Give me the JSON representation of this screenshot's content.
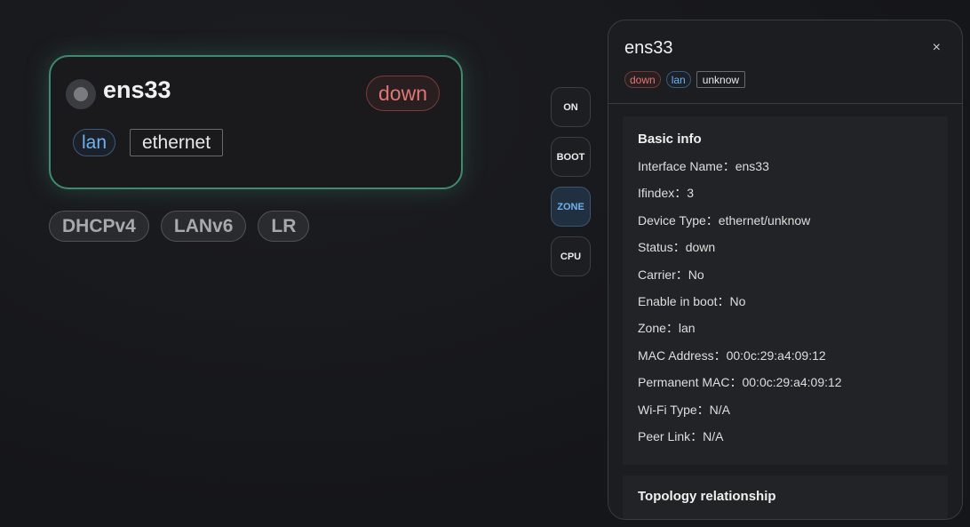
{
  "node": {
    "name": "ens33",
    "status": "down",
    "zone": "lan",
    "type": "ethernet",
    "services": [
      "DHCPv4",
      "LANv6",
      "LR"
    ]
  },
  "toggles": [
    {
      "label": "ON",
      "active": false
    },
    {
      "label": "BOOT",
      "active": false
    },
    {
      "label": "ZONE",
      "active": true
    },
    {
      "label": "CPU",
      "active": false
    }
  ],
  "panel": {
    "title": "ens33",
    "close": "×",
    "tags": {
      "status": "down",
      "zone": "lan",
      "type": "unknow"
    },
    "basic_info": {
      "title": "Basic info",
      "rows": [
        "Interface Name：ens33",
        "Ifindex：3",
        "Device Type：ethernet/unknow",
        "Status：down",
        "Carrier：No",
        "Enable in boot：No",
        "Zone：lan",
        "MAC Address：00:0c:29:a4:09:12",
        "Permanent MAC：00:0c:29:a4:09:12",
        "Wi-Fi Type：N/A",
        "Peer Link：N/A"
      ]
    },
    "topology": {
      "title": "Topology relationship"
    }
  },
  "colors": {
    "accent_green": "#3f8a6f",
    "status_down": "#e07676",
    "zone_blue": "#6fb1ec"
  }
}
